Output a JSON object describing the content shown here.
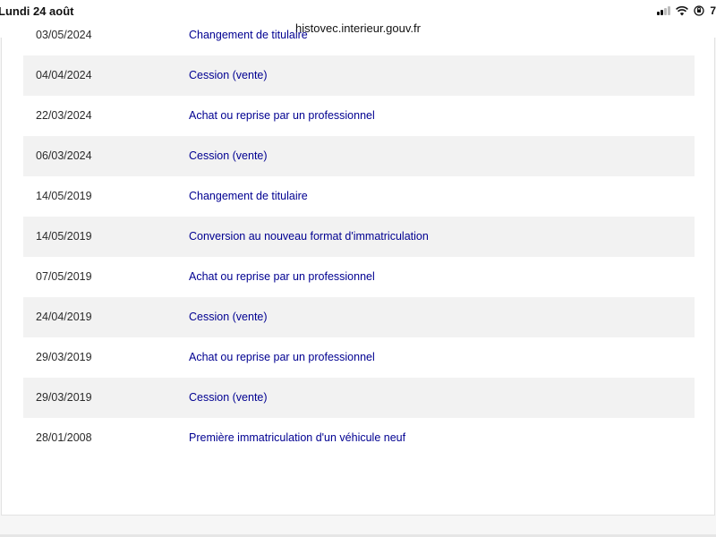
{
  "status_bar": {
    "time": "Lundi 24 août",
    "battery": "7",
    "icons": [
      "signal-icon",
      "wifi-icon",
      "orientation-lock-icon"
    ]
  },
  "browser": {
    "url": "histovec.interieur.gouv.fr"
  },
  "history": {
    "clipped_row": {
      "date": "03/05/2024",
      "event": "Changement de titulaire"
    },
    "rows": [
      {
        "date": "04/04/2024",
        "event": "Cession (vente)"
      },
      {
        "date": "22/03/2024",
        "event": "Achat ou reprise par un professionnel"
      },
      {
        "date": "06/03/2024",
        "event": "Cession (vente)"
      },
      {
        "date": "14/05/2019",
        "event": "Changement de titulaire"
      },
      {
        "date": "14/05/2019",
        "event": "Conversion au nouveau format d'immatriculation"
      },
      {
        "date": "07/05/2019",
        "event": "Achat ou reprise par un professionnel"
      },
      {
        "date": "24/04/2019",
        "event": "Cession (vente)"
      },
      {
        "date": "29/03/2019",
        "event": "Achat ou reprise par un professionnel"
      },
      {
        "date": "29/03/2019",
        "event": "Cession (vente)"
      },
      {
        "date": "28/01/2008",
        "event": "Première immatriculation d'un véhicule neuf"
      }
    ]
  },
  "colors": {
    "event_link": "#000091",
    "row_shade": "#f2f2f2",
    "page_bg": "#f6f6f6"
  }
}
